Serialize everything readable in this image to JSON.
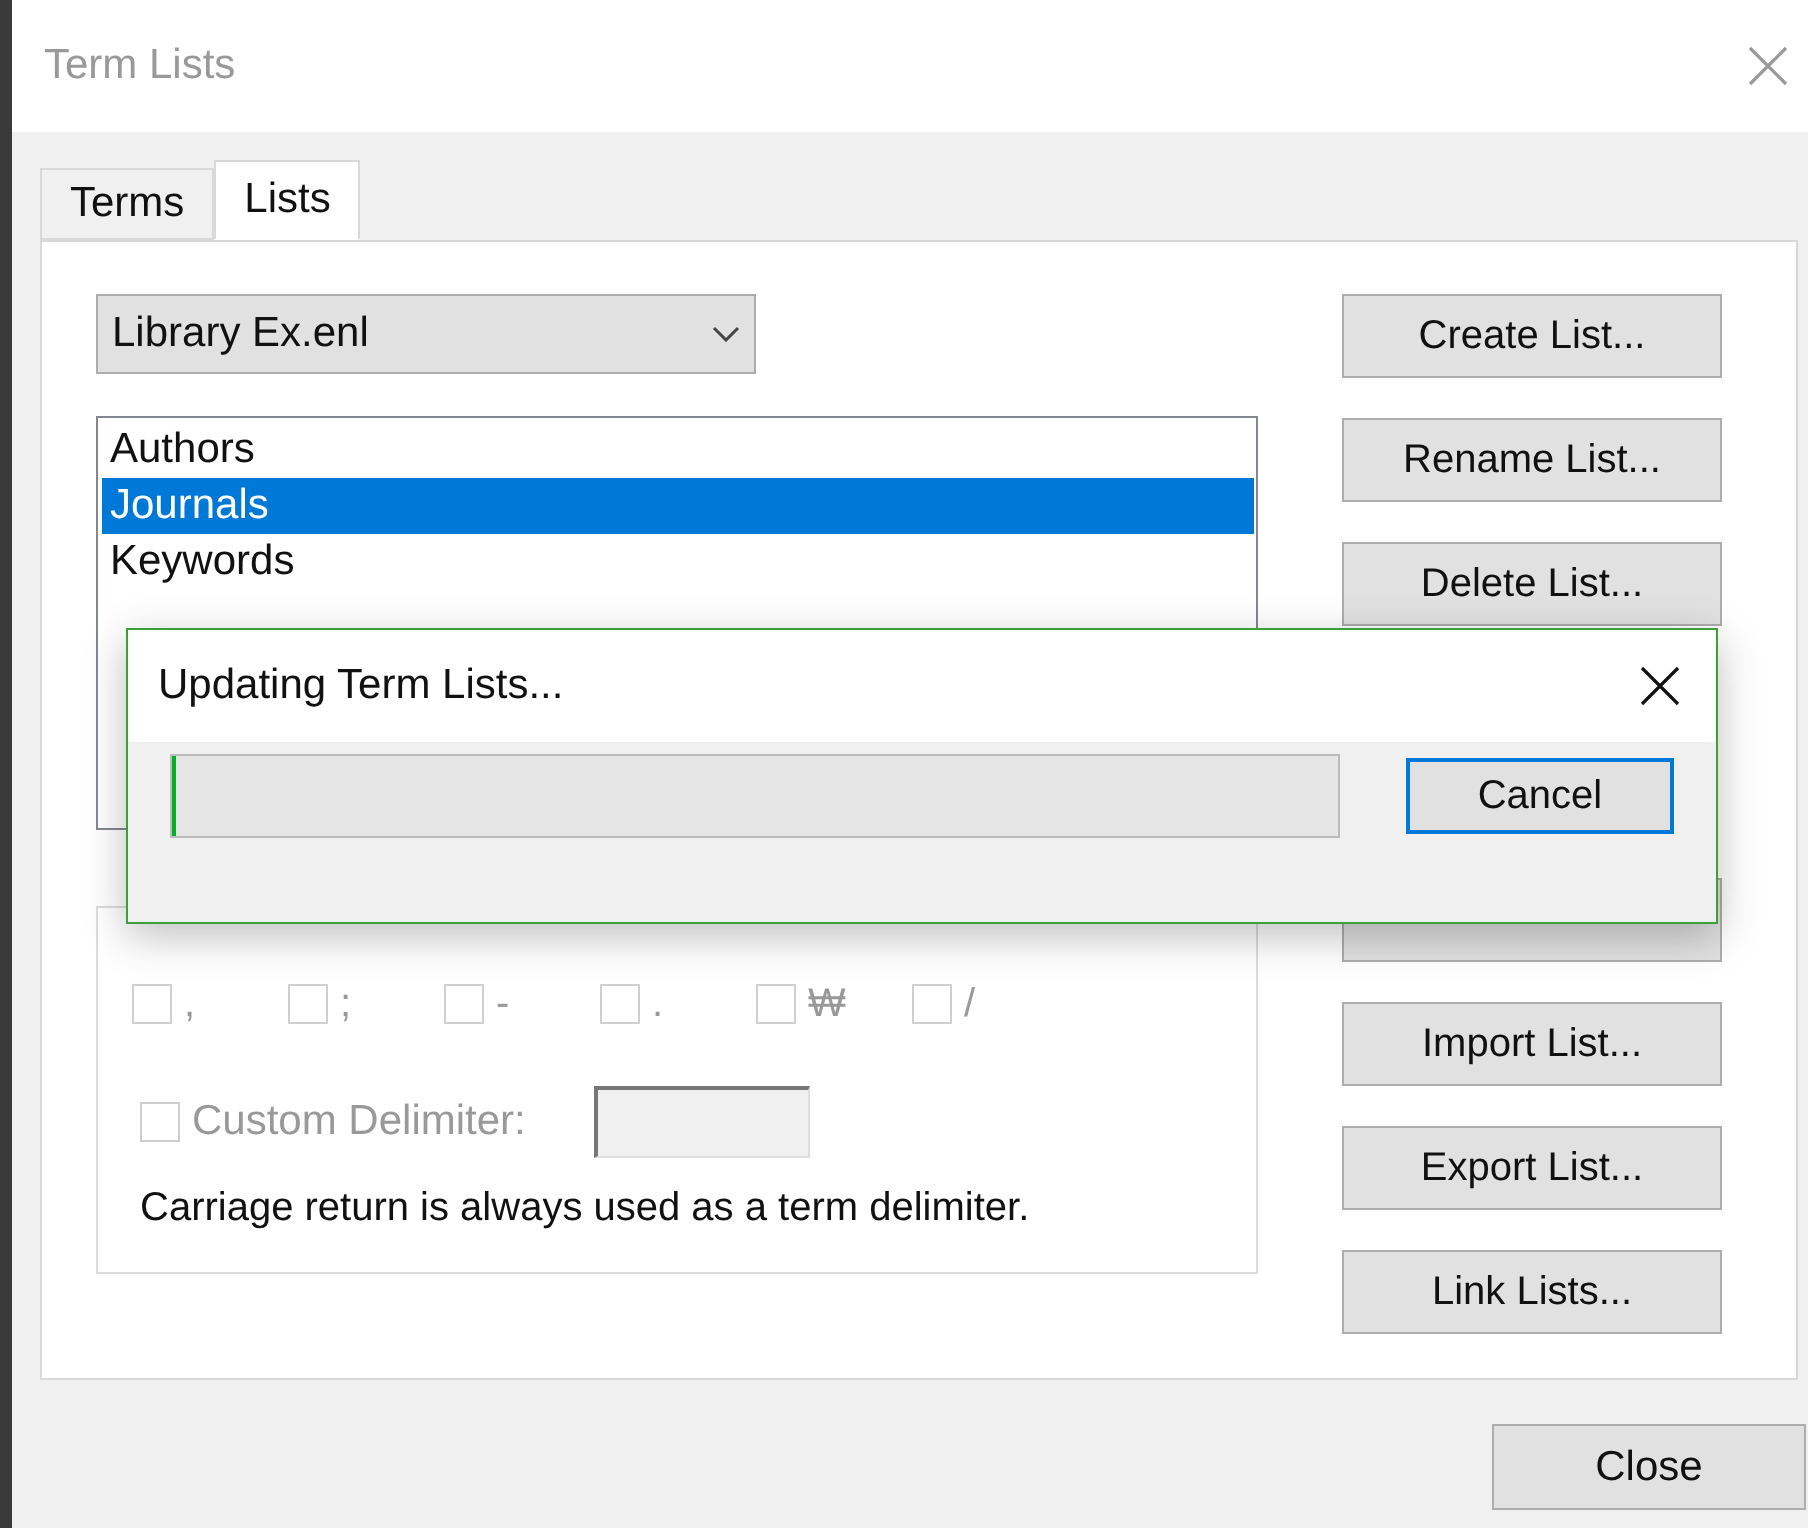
{
  "window": {
    "title": "Term Lists"
  },
  "tabs": [
    {
      "label": "Terms",
      "selected": false
    },
    {
      "label": "Lists",
      "selected": true
    }
  ],
  "library_dropdown": {
    "value": "Library Ex.enl"
  },
  "term_lists": [
    {
      "label": "Authors",
      "selected": false
    },
    {
      "label": "Journals",
      "selected": true
    },
    {
      "label": "Keywords",
      "selected": false
    }
  ],
  "delimiters": [
    {
      "label": ",",
      "checked": false,
      "disabled": true
    },
    {
      "label": ";",
      "checked": false,
      "disabled": true
    },
    {
      "label": "-",
      "checked": false,
      "disabled": true
    },
    {
      "label": ".",
      "checked": false,
      "disabled": true
    },
    {
      "label": "₩",
      "checked": false,
      "disabled": true
    },
    {
      "label": "/",
      "checked": false,
      "disabled": true
    }
  ],
  "custom_delimiter": {
    "label": "Custom Delimiter:",
    "checked": false,
    "disabled": true
  },
  "note": "Carriage return is always used as a term delimiter.",
  "side_buttons_top": [
    "Create List...",
    "Rename List...",
    "Delete List..."
  ],
  "side_buttons_bottom": [
    "Import List...",
    "Export List...",
    "Link Lists..."
  ],
  "close_button": "Close",
  "progress_dialog": {
    "title": "Updating Term Lists...",
    "level": 0.003,
    "cancel_button": "Cancel"
  }
}
